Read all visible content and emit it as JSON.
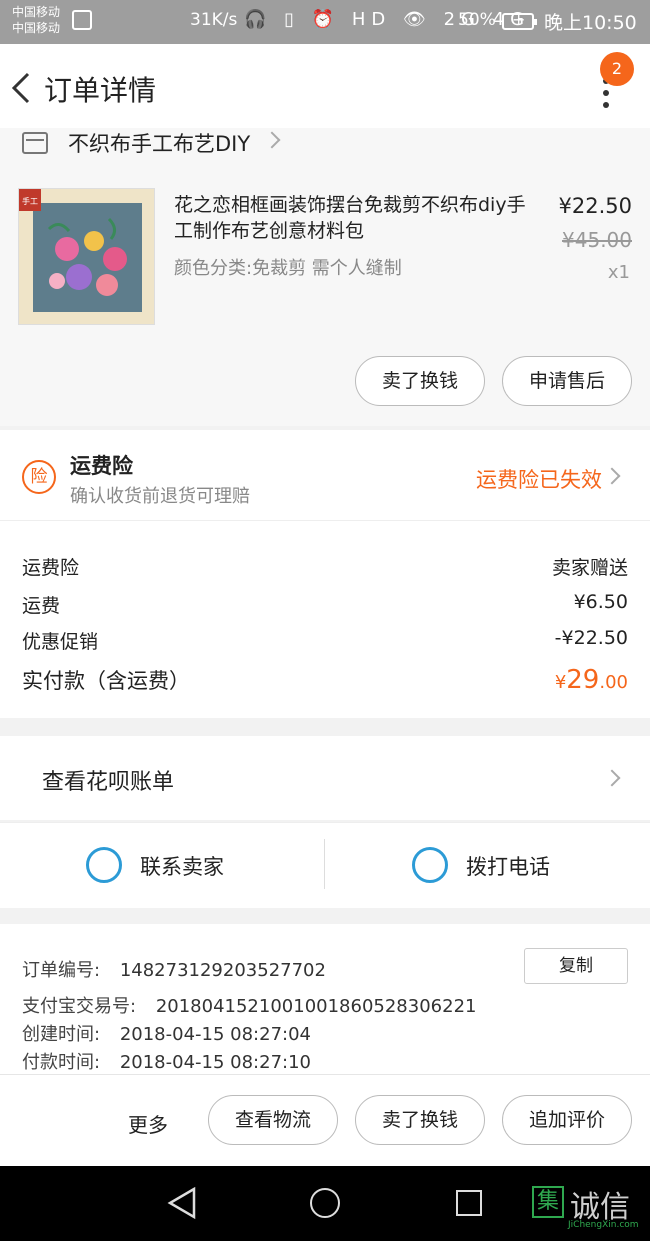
{
  "status_bar": {
    "carrier_line1": "中国移动",
    "carrier_line2": "中国移动",
    "speed": "31K/s",
    "icons": "🎧 ▯ ⏰ HD 👁 2G 4G",
    "battery": "50%",
    "clock": "晚上10:50"
  },
  "header": {
    "title": "订单详情",
    "badge_count": "2"
  },
  "shop": {
    "name": "不织布手工布艺DIY"
  },
  "product": {
    "title": "花之恋相框画装饰摆台免裁剪不织布diy手工制作布艺创意材料包",
    "variant": "颜色分类:免裁剪 需个人缝制",
    "price": "¥22.50",
    "original_price": "¥45.00",
    "quantity": "x1",
    "thumb_badge": "手工"
  },
  "item_actions": {
    "resell": "卖了换钱",
    "after_sale": "申请售后"
  },
  "insurance": {
    "icon_text": "险",
    "title": "运费险",
    "subtitle": "确认收货前退货可理赔",
    "status": "运费险已失效"
  },
  "summary": {
    "rows": [
      {
        "label": "运费险",
        "value": "卖家赠送"
      },
      {
        "label": "运费",
        "value": "¥6.50"
      },
      {
        "label": "优惠促销",
        "value": "-¥22.50"
      }
    ],
    "total_label": "实付款（含运费）",
    "total_currency": "¥",
    "total_int": "29",
    "total_dec": ".00"
  },
  "huabei": {
    "label": "查看花呗账单"
  },
  "contact": {
    "seller": "联系卖家",
    "call": "拨打电话"
  },
  "order_info": {
    "order_no_label": "订单编号:",
    "order_no": "148273129203527702",
    "copy": "复制",
    "alipay_label": "支付宝交易号:",
    "alipay_no": "2018041521001001860528306221",
    "created_label": "创建时间:",
    "created": "2018-04-15 08:27:04",
    "paid_label": "付款时间:",
    "paid": "2018-04-15 08:27:10"
  },
  "bottom_bar": {
    "more": "更多",
    "logistics": "查看物流",
    "resell": "卖了换钱",
    "review": "追加评价"
  },
  "watermark": {
    "box": "集",
    "text": "诚信",
    "sub": "JiChengXin.com"
  },
  "colors": {
    "accent": "#f5661b",
    "blue": "#2c9bd6"
  }
}
